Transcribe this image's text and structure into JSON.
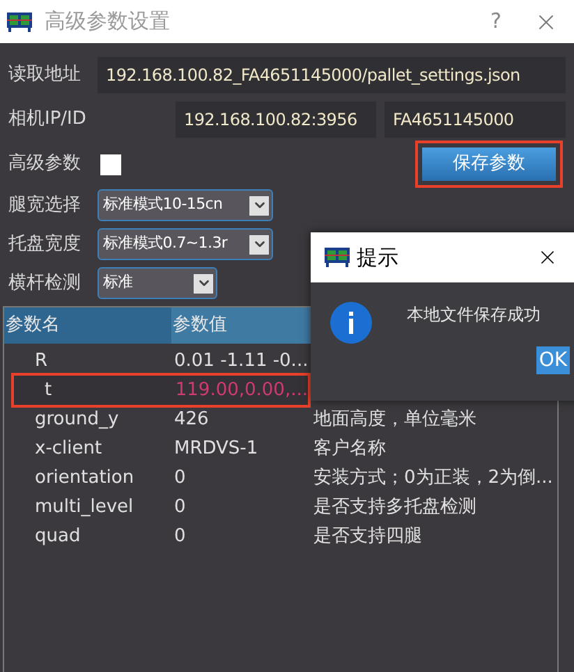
{
  "window": {
    "title": "高级参数设置",
    "help": "?"
  },
  "fields": [
    {
      "label": "读取地址",
      "values": [
        "192.168.100.82_FA4651145000/pallet_settings.json"
      ]
    },
    {
      "label": "相机IP/ID",
      "values": [
        "192.168.100.82:3956",
        "FA4651145000"
      ]
    }
  ],
  "advanced": {
    "label": "高级参数",
    "checked": false
  },
  "save_button": {
    "label": "保存参数",
    "highlighted": true
  },
  "combos": [
    {
      "label": "腿宽选择",
      "value": "标准模式10-15cn"
    },
    {
      "label": "托盘宽度",
      "value": "标准模式0.7~1.3r"
    },
    {
      "label": "横杆检测",
      "value": "标准"
    }
  ],
  "table": {
    "columns": [
      "参数名",
      "参数值"
    ],
    "rows": [
      {
        "name": "R",
        "value": "0.01 -1.11 -0...",
        "changed": false,
        "highlighted": false
      },
      {
        "name": "t",
        "value": "119.00,0.00,...",
        "changed": true,
        "highlighted": true
      },
      {
        "name": "ground_y",
        "value": "426",
        "description": "地面高度，单位毫米",
        "changed": false,
        "highlighted": false
      },
      {
        "name": "x-client",
        "value": "MRDVS-1",
        "description": "客户名称",
        "changed": false,
        "highlighted": false
      },
      {
        "name": "orientation",
        "value": "0",
        "description": "安装方式；0为正装，2为倒...",
        "changed": false,
        "highlighted": false
      },
      {
        "name": "multi_level",
        "value": "0",
        "description": "是否支持多托盘检测",
        "changed": false,
        "highlighted": false
      },
      {
        "name": "quad",
        "value": "0",
        "description": "是否支持四腿",
        "changed": false,
        "highlighted": false
      }
    ]
  },
  "dialog": {
    "title": "提示",
    "message": "本地文件保存成功",
    "ok": "OK"
  }
}
